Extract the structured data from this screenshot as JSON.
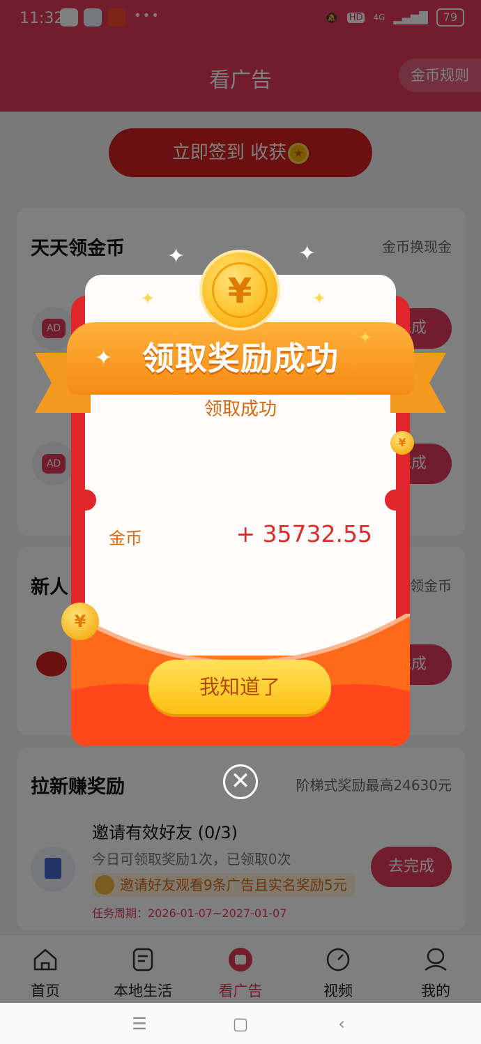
{
  "status_bar": {
    "time": "11:32",
    "dots": "•••",
    "hd": "HD",
    "network": "4G",
    "battery": "79"
  },
  "header": {
    "title": "看广告",
    "rules_button": "金币规则"
  },
  "checkin": {
    "label": "立即签到 收获"
  },
  "daily_card": {
    "title": "天天领金币",
    "subtitle": "金币换现金",
    "ad_badge": "AD",
    "task_button_partial": "完成"
  },
  "newbie_card": {
    "title_partial": "新人",
    "subtitle_partial": "领金币",
    "task_button_partial": "完成"
  },
  "invite_card": {
    "title": "拉新赚奖励",
    "subtitle": "阶梯式奖励最高24630元",
    "task_title": "邀请有效好友 (0/3)",
    "task_desc": "今日可领取奖励1次，已领取0次",
    "badge": "邀请好友观看9条广告且实名奖励5元",
    "period": "任务周期：2026-01-07~2027-01-07",
    "button": "去完成"
  },
  "bottom_nav": {
    "items": [
      {
        "label": "首页",
        "icon": "home-icon"
      },
      {
        "label": "本地生活",
        "icon": "local-life-icon"
      },
      {
        "label": "看广告",
        "icon": "watch-ad-icon"
      },
      {
        "label": "视频",
        "icon": "video-icon"
      },
      {
        "label": "我的",
        "icon": "profile-icon"
      }
    ],
    "active_index": 2
  },
  "modal": {
    "ribbon_title": "领取奖励成功",
    "success_text": "领取成功",
    "coin_label": "金币",
    "coin_value": "+ 35732.55",
    "confirm_button": "我知道了",
    "coin_symbol": "¥"
  },
  "colors": {
    "brand": "#e23a5c",
    "ribbon": "#f58b14",
    "reward_text": "#e02a2a"
  }
}
